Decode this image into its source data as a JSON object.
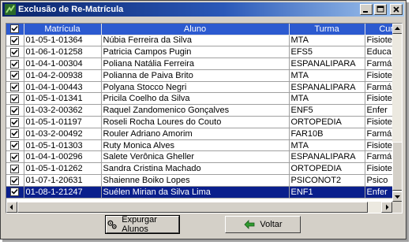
{
  "window": {
    "title": "Exclusão de Re-Matrícula"
  },
  "grid": {
    "columns": [
      "Matrícula",
      "Aluno",
      "Turma",
      "Curso"
    ],
    "rows": [
      {
        "checked": true,
        "matricula": "01-05-1-01364",
        "aluno": "Núbia Ferreira da Silva",
        "turma": "MTA",
        "curso": "Fisiote"
      },
      {
        "checked": true,
        "matricula": "01-06-1-01258",
        "aluno": "Patricia Campos Pugin",
        "turma": "EFS5",
        "curso": "Educa"
      },
      {
        "checked": true,
        "matricula": "01-04-1-00304",
        "aluno": "Poliana Natália Ferreira",
        "turma": "ESPANALIPARA",
        "curso": "Farmá"
      },
      {
        "checked": true,
        "matricula": "01-04-2-00938",
        "aluno": "Polianna de Paiva Brito",
        "turma": "MTA",
        "curso": "Fisiote"
      },
      {
        "checked": true,
        "matricula": "01-04-1-00443",
        "aluno": "Polyana Stocco Negri",
        "turma": "ESPANALIPARA",
        "curso": "Farmá"
      },
      {
        "checked": true,
        "matricula": "01-05-1-01341",
        "aluno": "Pricila Coelho da Silva",
        "turma": "MTA",
        "curso": "Fisiote"
      },
      {
        "checked": true,
        "matricula": "01-03-2-00362",
        "aluno": "Raquel Zandomenico Gonçalves",
        "turma": "ENF5",
        "curso": "Enfer"
      },
      {
        "checked": true,
        "matricula": "01-05-1-01197",
        "aluno": "Roseli Rocha Loures do Couto",
        "turma": "ORTOPEDIA",
        "curso": "Fisiote"
      },
      {
        "checked": true,
        "matricula": "01-03-2-00492",
        "aluno": "Rouler Adriano Amorim",
        "turma": "FAR10B",
        "curso": "Farmá"
      },
      {
        "checked": true,
        "matricula": "01-05-1-01303",
        "aluno": "Ruty Monica Alves",
        "turma": "MTA",
        "curso": "Fisiote"
      },
      {
        "checked": true,
        "matricula": "01-04-1-00296",
        "aluno": "Salete Verônica Gheller",
        "turma": "ESPANALIPARA",
        "curso": "Farmá"
      },
      {
        "checked": true,
        "matricula": "01-05-1-01262",
        "aluno": "Sandra Cristina Machado",
        "turma": "ORTOPEDIA",
        "curso": "Fisiote"
      },
      {
        "checked": true,
        "matricula": "01-07-1-20631",
        "aluno": "Shaienne Boiko Lopes",
        "turma": "PSICONOT2",
        "curso": "Psico"
      },
      {
        "checked": true,
        "matricula": "01-08-1-21247",
        "aluno": "Suélen Mirian da Silva Lima",
        "turma": "ENF1",
        "curso": "Enfer",
        "selected": true
      }
    ]
  },
  "buttons": {
    "purge_label": "Expurgar Alunos",
    "back_label": "Voltar"
  },
  "colors": {
    "header": "#2c5ad0",
    "selection": "#0a1f8c",
    "face": "#d4d0c8"
  }
}
